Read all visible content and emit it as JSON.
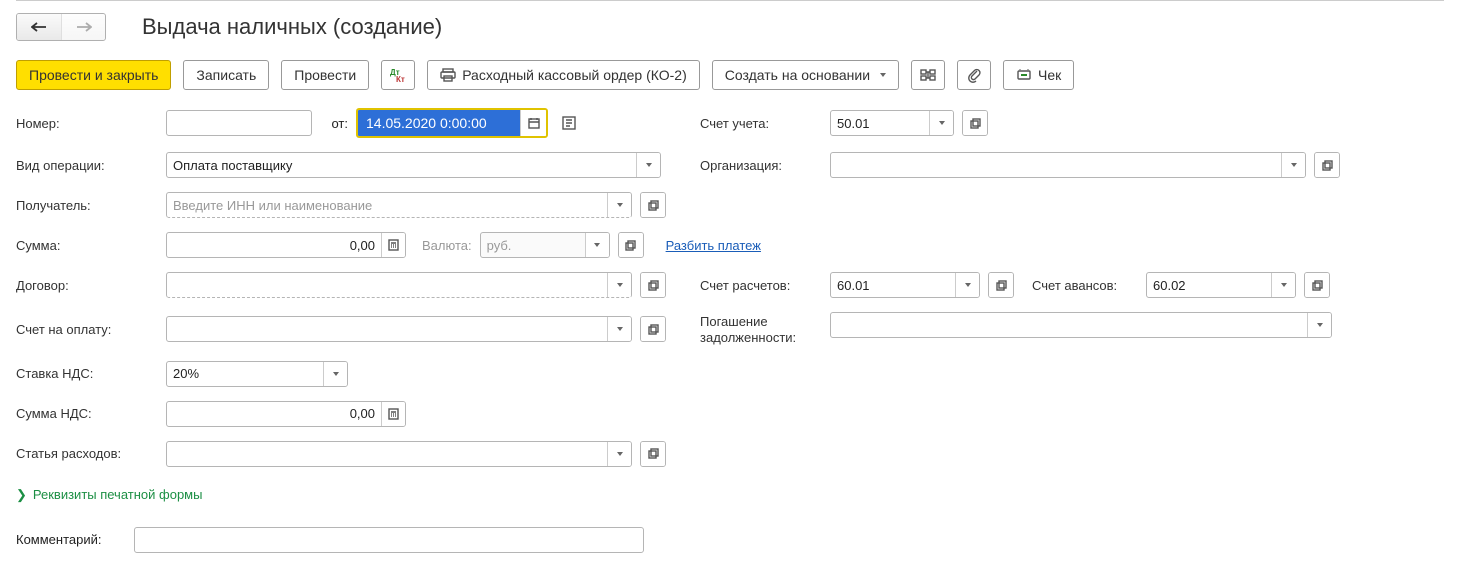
{
  "title": "Выдача наличных (создание)",
  "toolbar": {
    "submitClose": "Провести и закрыть",
    "save": "Записать",
    "submit": "Провести",
    "printDoc": "Расходный кассовый ордер (КО-2)",
    "createBasedOn": "Создать на основании",
    "receipt": "Чек"
  },
  "left": {
    "numberLbl": "Номер:",
    "fromLbl": "от:",
    "dateVal": "14.05.2020  0:00:00",
    "opTypeLbl": "Вид операции:",
    "opTypeVal": "Оплата поставщику",
    "recipientLbl": "Получатель:",
    "recipientPH": "Введите ИНН или наименование",
    "sumLbl": "Сумма:",
    "sumVal": "0,00",
    "currencyLbl": "Валюта:",
    "currencyVal": "руб.",
    "splitLink": "Разбить платеж",
    "contractLbl": "Договор:",
    "invoiceLbl": "Счет на оплату:",
    "vatRateLbl": "Ставка НДС:",
    "vatRateVal": "20%",
    "vatSumLbl": "Сумма НДС:",
    "vatSumVal": "0,00",
    "expenseItemLbl": "Статья расходов:"
  },
  "right": {
    "accountLbl": "Счет учета:",
    "accountVal": "50.01",
    "orgLbl": "Организация:",
    "calcAcctLbl": "Счет расчетов:",
    "calcAcctVal": "60.01",
    "advAcctLbl": "Счет авансов:",
    "advAcctVal": "60.02",
    "debtLbl1": "Погашение",
    "debtLbl2": "задолженности:"
  },
  "collapse": "Реквизиты печатной формы",
  "commentLbl": "Комментарий:"
}
